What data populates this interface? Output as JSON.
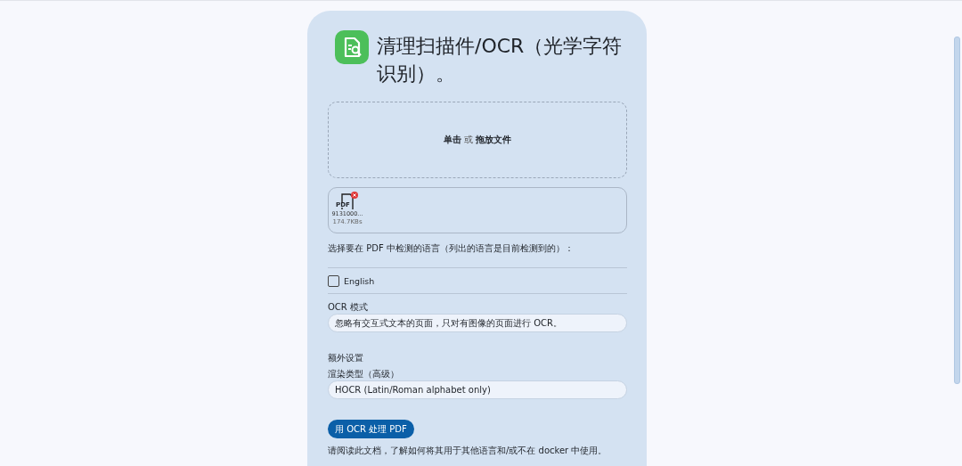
{
  "title": "清理扫描件/OCR（光学字符识别）。",
  "dropzone": {
    "click": "单击",
    "or": "或",
    "drop": "拖放文件"
  },
  "file": {
    "type": "PDF",
    "name": "9131000...",
    "size": "174.7KBs"
  },
  "language_prompt": "选择要在 PDF 中检测的语言（列出的语言是目前检测到的）：",
  "languages": [
    {
      "label": "English",
      "checked": false
    }
  ],
  "ocr_mode": {
    "label": "OCR 模式",
    "value": "忽略有交互式文本的页面，只对有图像的页面进行 OCR。"
  },
  "extra_settings": "额外设置",
  "render_type": {
    "label": "渲染类型（高级）",
    "value": "HOCR (Latin/Roman alphabet only)"
  },
  "submit_button": "用 OCR 处理 PDF",
  "note": "请阅读此文档，了解如何将其用于其他语言和/或不在 docker 中使用。"
}
